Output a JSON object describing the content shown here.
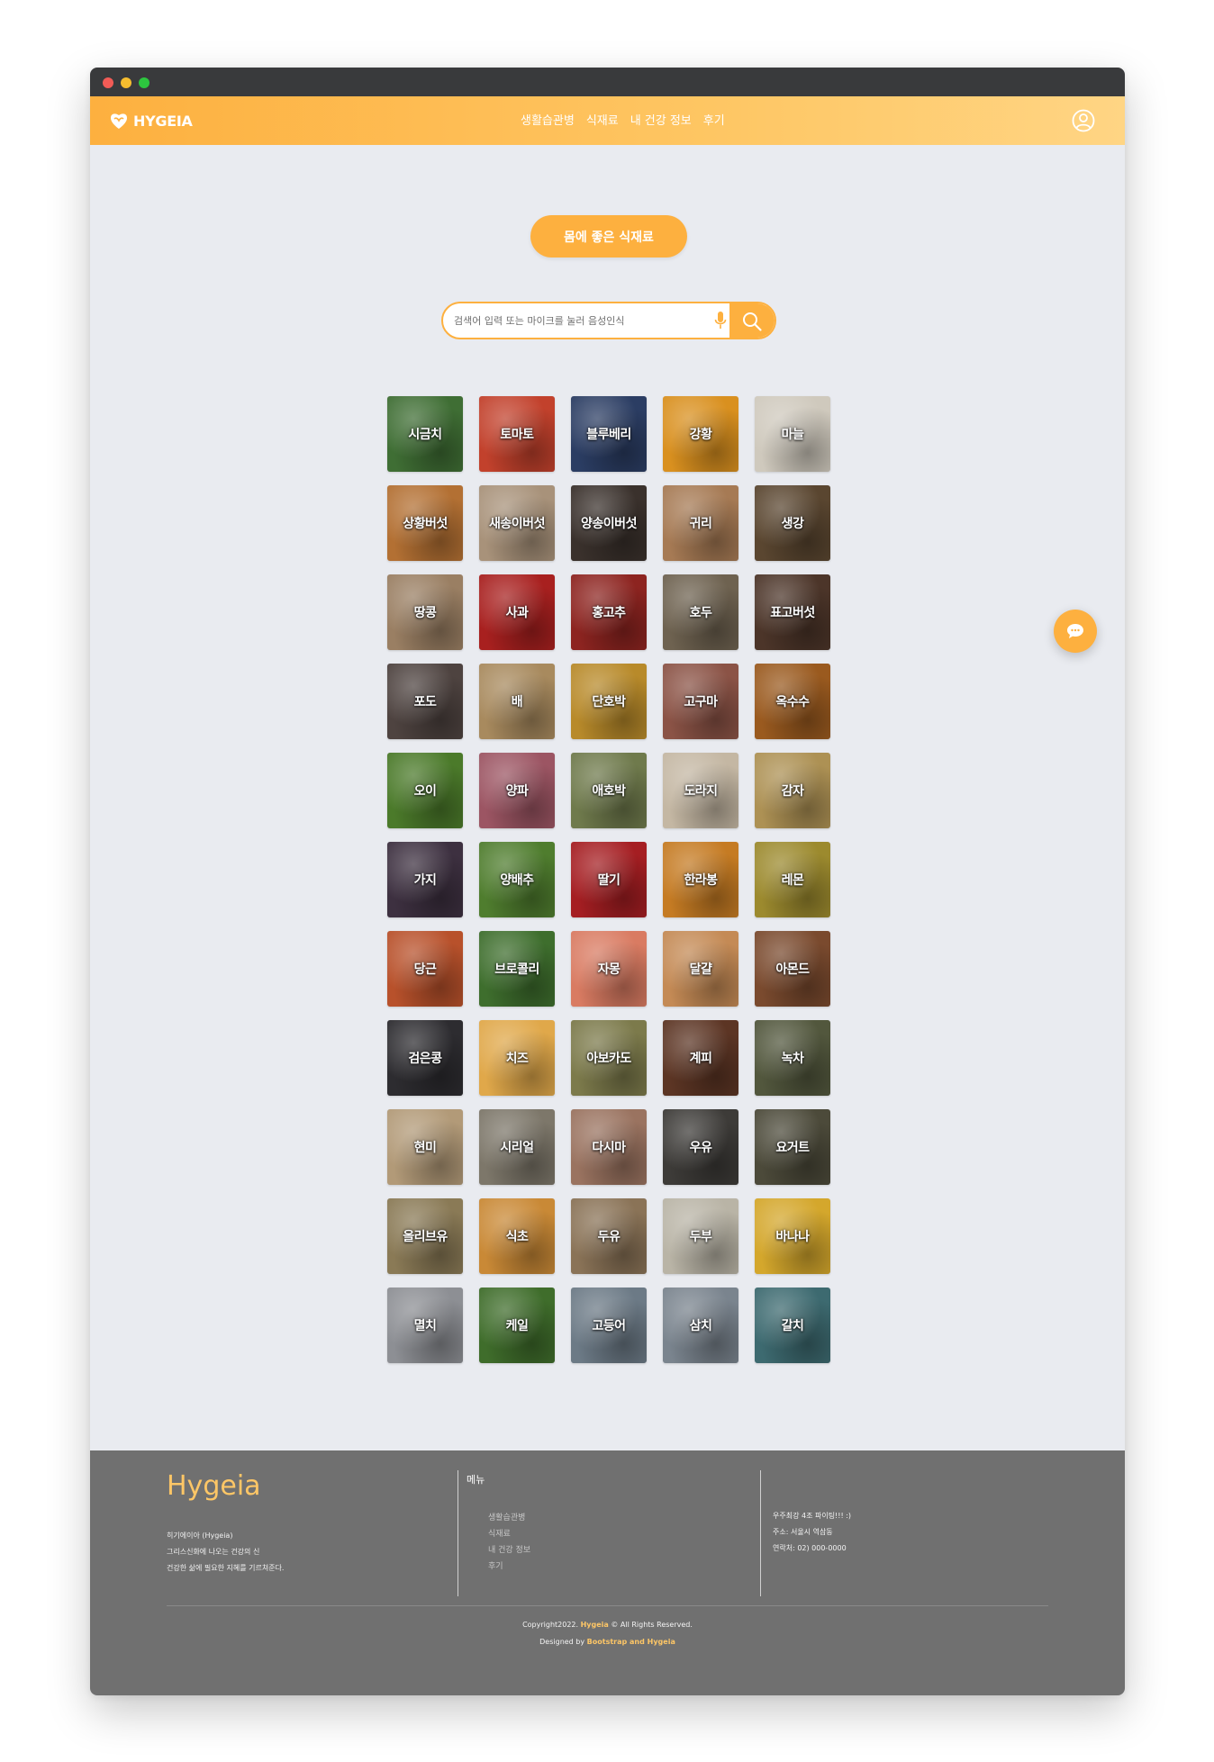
{
  "app": {
    "brand": "HYGEIA",
    "nav": [
      "생활습관병",
      "식재료",
      "내 건강 정보",
      "후기"
    ],
    "accent_color": "#fdb03f",
    "icons": [
      "hygeia-logo-icon",
      "user-circle-icon",
      "mic-icon",
      "search-icon",
      "chat-bubble-icon"
    ]
  },
  "main": {
    "heading_button": "몸에 좋은 식재료",
    "search": {
      "placeholder": "검색어 입력 또는 마이크를 눌러 음성인식",
      "value": ""
    },
    "ingredients": [
      {
        "label": "시금치",
        "color": "#3f6e34"
      },
      {
        "label": "토마토",
        "color": "#c2412c"
      },
      {
        "label": "블루베리",
        "color": "#2b3d63"
      },
      {
        "label": "강황",
        "color": "#d9901f"
      },
      {
        "label": "마늘",
        "color": "#cfc9bd"
      },
      {
        "label": "상황버섯",
        "color": "#b37033"
      },
      {
        "label": "새송이버섯",
        "color": "#a8927a"
      },
      {
        "label": "양송이버섯",
        "color": "#3a312c"
      },
      {
        "label": "귀리",
        "color": "#a67a54"
      },
      {
        "label": "생강",
        "color": "#5a4630"
      },
      {
        "label": "땅콩",
        "color": "#9a7f63"
      },
      {
        "label": "사과",
        "color": "#a8201f"
      },
      {
        "label": "홍고추",
        "color": "#8d2420"
      },
      {
        "label": "호두",
        "color": "#6e6250"
      },
      {
        "label": "표고버섯",
        "color": "#4c3529"
      },
      {
        "label": "포도",
        "color": "#4e4340"
      },
      {
        "label": "배",
        "color": "#a88a5e"
      },
      {
        "label": "단호박",
        "color": "#b88a2a"
      },
      {
        "label": "고구마",
        "color": "#8b5346"
      },
      {
        "label": "옥수수",
        "color": "#9a5a1f"
      },
      {
        "label": "오이",
        "color": "#4b7a2a"
      },
      {
        "label": "양파",
        "color": "#9c5563"
      },
      {
        "label": "애호박",
        "color": "#6f7a4c"
      },
      {
        "label": "도라지",
        "color": "#c4b7a3"
      },
      {
        "label": "감자",
        "color": "#ad9154"
      },
      {
        "label": "가지",
        "color": "#3d3040"
      },
      {
        "label": "양배추",
        "color": "#4f7d2e"
      },
      {
        "label": "딸기",
        "color": "#a51e22"
      },
      {
        "label": "한라봉",
        "color": "#c57b23"
      },
      {
        "label": "레몬",
        "color": "#9c8a2e"
      },
      {
        "label": "당근",
        "color": "#b8512b"
      },
      {
        "label": "브로콜리",
        "color": "#3e6e2d"
      },
      {
        "label": "자몽",
        "color": "#d97b62"
      },
      {
        "label": "달걀",
        "color": "#c48a55"
      },
      {
        "label": "아몬드",
        "color": "#7a4a2e"
      },
      {
        "label": "검은콩",
        "color": "#2d2c30"
      },
      {
        "label": "치즈",
        "color": "#e0a84a"
      },
      {
        "label": "아보카도",
        "color": "#7c7a4b"
      },
      {
        "label": "계피",
        "color": "#5c3524"
      },
      {
        "label": "녹차",
        "color": "#52573d"
      },
      {
        "label": "현미",
        "color": "#b29a78"
      },
      {
        "label": "시리얼",
        "color": "#7d776a"
      },
      {
        "label": "다시마",
        "color": "#9a7360"
      },
      {
        "label": "우유",
        "color": "#3d3b38"
      },
      {
        "label": "요거트",
        "color": "#4c4a3a"
      },
      {
        "label": "올리브유",
        "color": "#8a7a56"
      },
      {
        "label": "식초",
        "color": "#c98936"
      },
      {
        "label": "두유",
        "color": "#8a7357"
      },
      {
        "label": "두부",
        "color": "#b9b4a6"
      },
      {
        "label": "바나나",
        "color": "#d4a72c"
      },
      {
        "label": "멸치",
        "color": "#8d8f94"
      },
      {
        "label": "케일",
        "color": "#3f6d2b"
      },
      {
        "label": "고등어",
        "color": "#6c7a86"
      },
      {
        "label": "삼치",
        "color": "#7a848e"
      },
      {
        "label": "갈치",
        "color": "#3d6a70"
      }
    ]
  },
  "footer": {
    "logo": "Hygeia",
    "desc": [
      "히기에이아 (Hygeia)",
      "그리스신화에 나오는 건강의 신",
      "건강한 삶에 필요한 지혜를 기르쳐준다."
    ],
    "menu_title": "메뉴",
    "menu": [
      "생활습관병",
      "식재료",
      "내 건강 정보",
      "후기"
    ],
    "contact": [
      "우주최강 4조 파이팅!!! :)",
      "주소: 서울시 역삼동",
      "연락처: 02) 000-0000"
    ],
    "copyright_pre": "Copyright2022.",
    "copyright_brand": "Hygeia",
    "copyright_post": "© All Rights Reserved.",
    "designed_pre": "Designed by",
    "designed_by": "Bootstrap and Hygeia"
  }
}
